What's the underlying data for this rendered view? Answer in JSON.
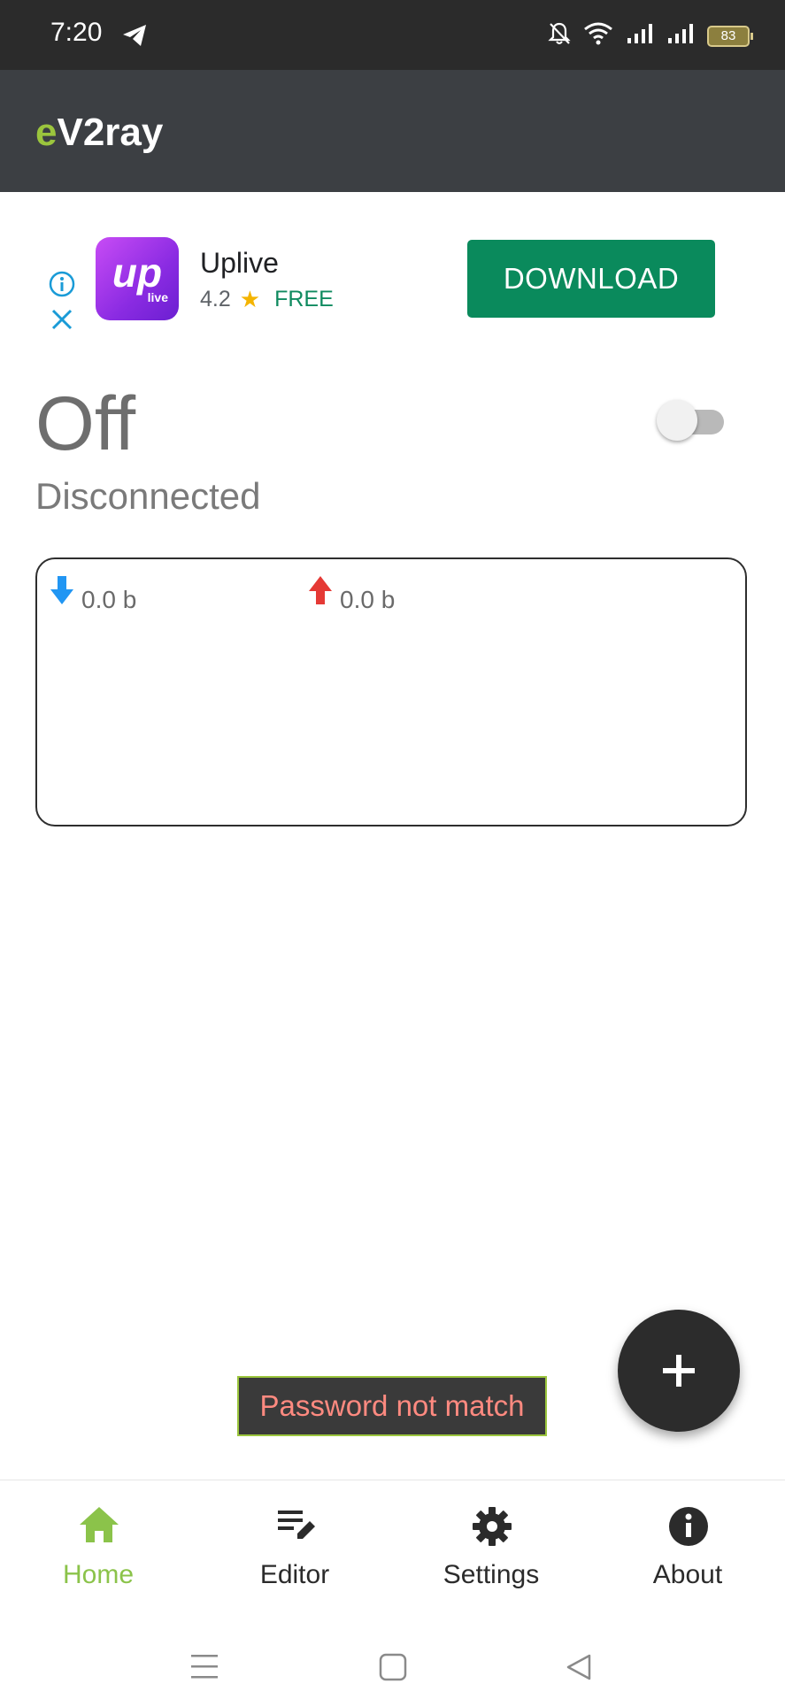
{
  "status_bar": {
    "time": "7:20",
    "battery": "83"
  },
  "app": {
    "title_accent": "e",
    "title_rest": "V2ray"
  },
  "ad": {
    "app_name": "Uplive",
    "logo_text": "up",
    "logo_sub": "live",
    "rating": "4.2",
    "price": "FREE",
    "cta": "DOWNLOAD"
  },
  "connection": {
    "state": "Off",
    "status": "Disconnected",
    "toggle_on": false
  },
  "traffic": {
    "download": "0.0 b",
    "upload": "0.0 b"
  },
  "toast": {
    "message": "Password not match"
  },
  "bottom_nav": {
    "items": [
      {
        "label": "Home",
        "icon": "home-icon",
        "active": true
      },
      {
        "label": "Editor",
        "icon": "edit-icon",
        "active": false
      },
      {
        "label": "Settings",
        "icon": "gear-icon",
        "active": false
      },
      {
        "label": "About",
        "icon": "info-icon",
        "active": false
      }
    ]
  },
  "colors": {
    "accent": "#8bc34a",
    "appbar": "#3c3f43",
    "download_arrow": "#2196f3",
    "upload_arrow": "#e53935",
    "ad_button": "#0a8a5c"
  }
}
